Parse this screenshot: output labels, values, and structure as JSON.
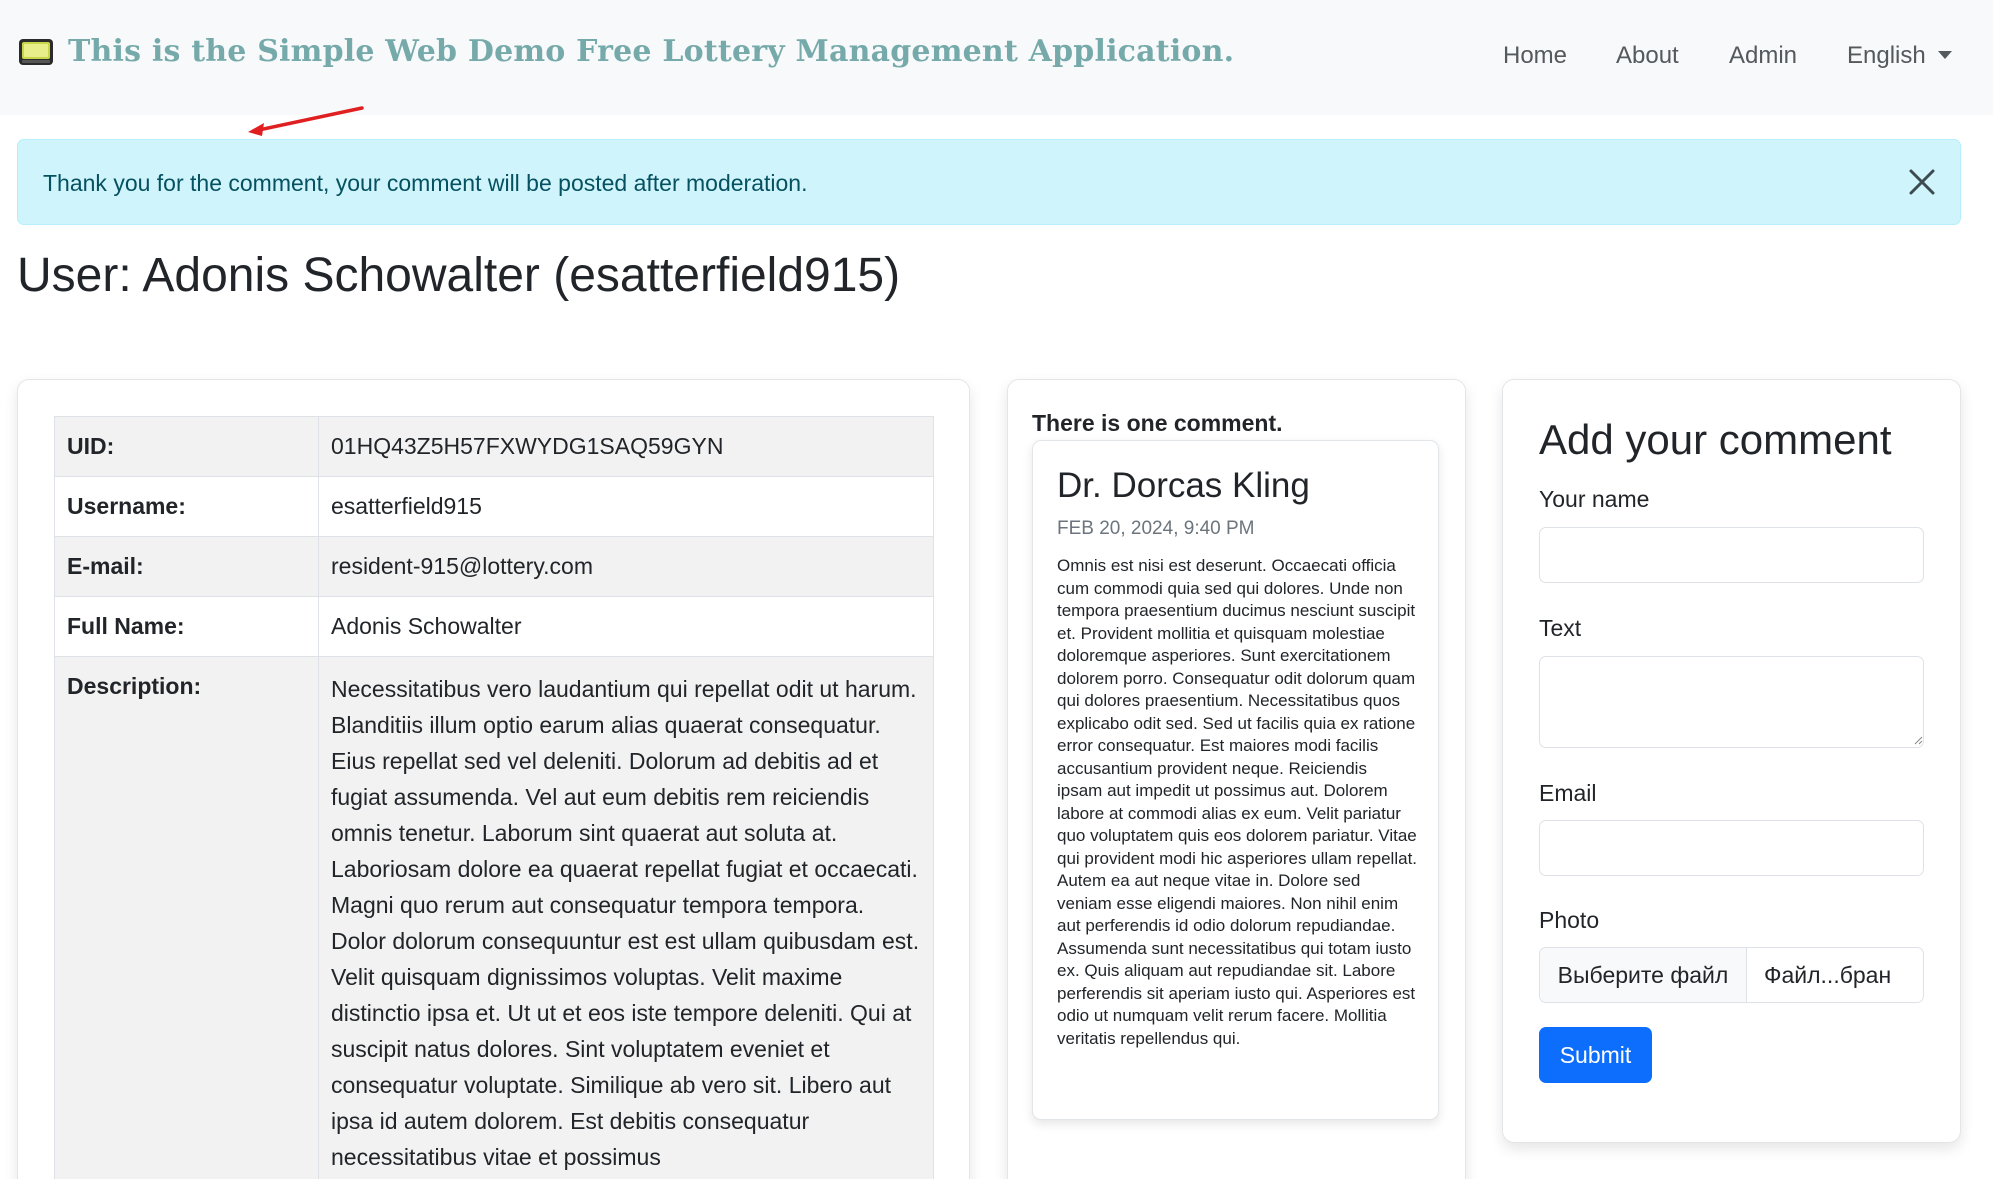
{
  "navbar": {
    "brand_text": "This is the Simple Web Demo Free Lottery Management Application.",
    "brand_icon": "lottery-machine-icon",
    "links": [
      "Home",
      "About",
      "Admin"
    ],
    "language": "English"
  },
  "alert": {
    "text": "Thank you for the comment, your comment will be posted after moderation."
  },
  "page": {
    "title": "User: Adonis Schowalter (esatterfield915)"
  },
  "user": {
    "rows": [
      {
        "label": "UID:",
        "value": "01HQ43Z5H57FXWYDG1SAQ59GYN"
      },
      {
        "label": "Username:",
        "value": "esatterfield915"
      },
      {
        "label": "E-mail:",
        "value": "resident-915@lottery.com"
      },
      {
        "label": "Full Name:",
        "value": "Adonis Schowalter"
      },
      {
        "label": "Description:",
        "value": "Necessitatibus vero laudantium qui repellat odit ut harum. Blanditiis illum optio earum alias quaerat consequatur. Eius repellat sed vel deleniti. Dolorum ad debitis ad et fugiat assumenda. Vel aut eum debitis rem reiciendis omnis tenetur. Laborum sint quaerat aut soluta at. Laboriosam dolore ea quaerat repellat fugiat et occaecati. Magni quo rerum aut consequatur tempora tempora. Dolor dolorum consequuntur est est ullam quibusdam est. Velit quisquam dignissimos voluptas. Velit maxime distinctio ipsa et. Ut ut et eos iste tempore deleniti. Qui at suscipit natus dolores. Sint voluptatem eveniet et consequatur voluptate. Similique ab vero sit. Libero aut ipsa id autem dolorem. Est debitis consequatur necessitatibus vitae et possimus"
      }
    ]
  },
  "comments": {
    "count_text": "There is one comment.",
    "items": [
      {
        "author": "Dr. Dorcas Kling",
        "date": "FEB 20, 2024, 9:40 PM",
        "text": "Omnis est nisi est deserunt. Occaecati officia cum commodi quia sed qui dolores. Unde non tempora praesentium ducimus nesciunt suscipit et. Provident mollitia et quisquam molestiae doloremque asperiores. Sunt exercitationem dolorem porro. Consequatur odit dolorum quam qui dolores praesentium. Necessitatibus quos explicabo odit sed. Sed ut facilis quia ex ratione error consequatur. Est maiores modi facilis accusantium provident neque. Reiciendis ipsam aut impedit ut possimus aut. Dolorem labore at commodi alias ex eum. Velit pariatur quo voluptatem quis eos dolorem pariatur. Vitae qui provident modi hic asperiores ullam repellat. Autem ea aut neque vitae in. Dolore sed veniam esse eligendi maiores. Non nihil enim aut perferendis id odio dolorum repudiandae. Assumenda sunt necessitatibus qui totam iusto ex. Quis aliquam aut repudiandae sit. Labore perferendis sit aperiam iusto qui. Asperiores est odio ut numquam velit rerum facere. Mollitia veritatis repellendus qui."
      }
    ]
  },
  "form": {
    "title": "Add your comment",
    "name_label": "Your name",
    "name_value": "",
    "text_label": "Text",
    "text_value": "",
    "email_label": "Email",
    "email_value": "",
    "photo_label": "Photo",
    "file_button": "Выберите файл",
    "file_name": "Файл...бран",
    "submit_label": "Submit"
  },
  "colors": {
    "brand": "#76aaaa",
    "alert_bg": "#cff4fc",
    "alert_text": "#055160",
    "primary": "#0d6efd",
    "annotation_arrow": "#e02020"
  }
}
